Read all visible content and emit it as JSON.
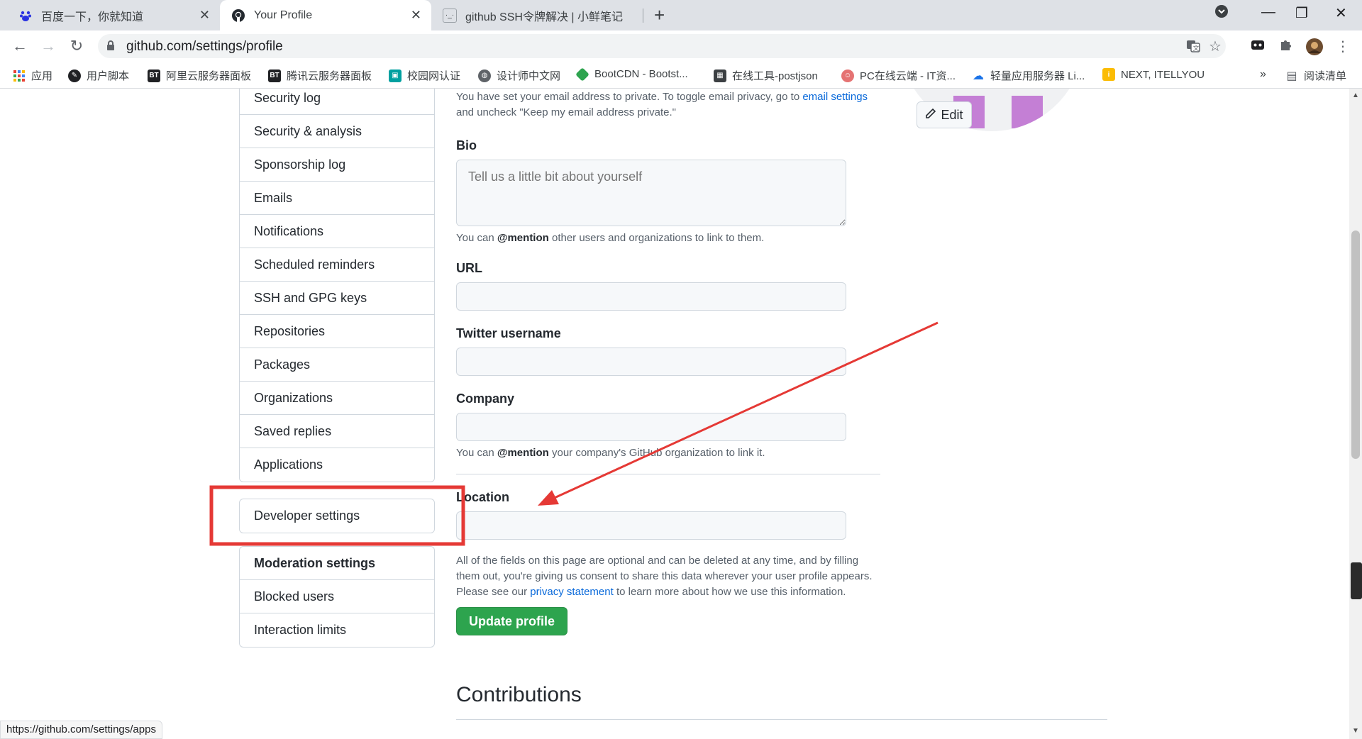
{
  "tabs": [
    {
      "title": "百度一下，你就知道",
      "icon": "baidu-icon"
    },
    {
      "title": "Your Profile",
      "icon": "github-icon"
    },
    {
      "title": "github SSH令牌解决 | 小鲜笔记",
      "icon": "site-icon"
    }
  ],
  "address_bar": {
    "url": "github.com/settings/profile"
  },
  "bookmarks": [
    {
      "label": "应用",
      "color": "#ea4335"
    },
    {
      "label": "用户脚本",
      "color": "#202124"
    },
    {
      "label": "阿里云服务器面板",
      "color": "#202124"
    },
    {
      "label": "腾讯云服务器面板",
      "color": "#202124"
    },
    {
      "label": "校园网认证",
      "color": "#00a0a0"
    },
    {
      "label": "设计师中文网",
      "color": "#5f6368"
    },
    {
      "label": "BootCDN - Bootst...",
      "color": "#2ea44f"
    },
    {
      "label": "在线工具-postjson",
      "color": "#3c4043"
    },
    {
      "label": "PC在线云端 - IT资...",
      "color": "#e57373"
    },
    {
      "label": "轻量应用服务器 Li...",
      "color": "#1a73e8"
    },
    {
      "label": "NEXT, ITELLYOU",
      "color": "#fbbc04"
    }
  ],
  "bookmarks_overflow": "»",
  "reading_list": "阅读清单",
  "sidebar": {
    "group1": [
      "Security log",
      "Security & analysis",
      "Sponsorship log",
      "Emails",
      "Notifications",
      "Scheduled reminders",
      "SSH and GPG keys",
      "Repositories",
      "Packages",
      "Organizations",
      "Saved replies",
      "Applications"
    ],
    "developer": "Developer settings",
    "moderation_heading": "Moderation settings",
    "moderation": [
      "Blocked users",
      "Interaction limits"
    ]
  },
  "form": {
    "email_note_1": "You have set your email address to private. To toggle email privacy, go to ",
    "email_note_link": "email settings",
    "email_note_2": "and uncheck \"Keep my email address private.\"",
    "bio_label": "Bio",
    "bio_placeholder": "Tell us a little bit about yourself",
    "bio_note_1": "You can ",
    "bio_note_mention": "@mention",
    "bio_note_2": " other users and organizations to link to them.",
    "url_label": "URL",
    "twitter_label": "Twitter username",
    "company_label": "Company",
    "company_note_1": "You can ",
    "company_note_mention": "@mention",
    "company_note_2": " your company's GitHub organization to link it.",
    "location_label": "Location",
    "consent_1": "All of the fields on this page are optional and can be deleted at any time, and by filling",
    "consent_2": "them out, you're giving us consent to share this data wherever your user profile appears.",
    "consent_3a": "Please see our ",
    "consent_link": "privacy statement",
    "consent_3b": " to learn more about how we use this information.",
    "update_button": "Update profile"
  },
  "avatar_edit": "Edit",
  "contributions_title": "Contributions",
  "status_url": "https://github.com/settings/apps",
  "annotation_color": "#e53935"
}
